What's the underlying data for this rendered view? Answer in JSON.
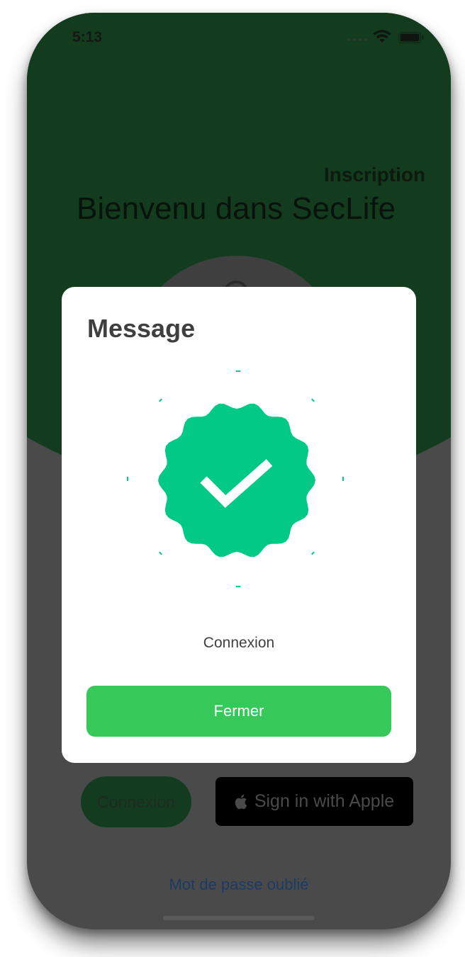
{
  "status_bar": {
    "time": "5:13",
    "icons": [
      "signal-dots-icon",
      "wifi-icon",
      "battery-icon"
    ]
  },
  "header": {
    "signup_label": "Inscription",
    "welcome_title": "Bienvenu dans SecLife"
  },
  "actions": {
    "login_label": "Connexion",
    "apple_label": "Sign in with Apple",
    "forgot_password_label": "Mot de passe oublié"
  },
  "modal": {
    "title": "Message",
    "icon": "check-badge-icon",
    "message": "Connexion",
    "close_label": "Fermer"
  },
  "colors": {
    "brand_dark_green": "#133c1f",
    "success_green": "#02c986",
    "button_green": "#37c85a",
    "link_blue": "#1d3a63"
  }
}
